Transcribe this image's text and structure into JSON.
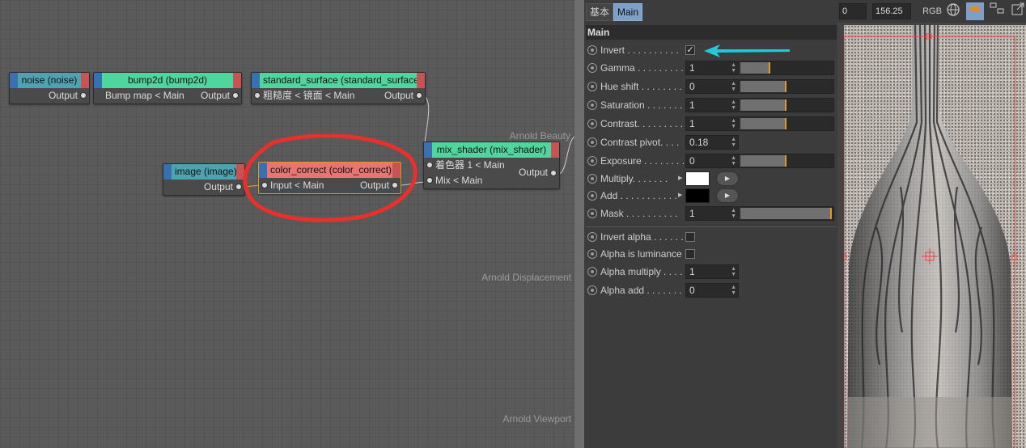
{
  "node_editor": {
    "nodes": {
      "noise": {
        "title": "noise (noise)",
        "output": "Output",
        "color": "#4fa3b0"
      },
      "bump2d": {
        "title": "bump2d (bump2d)",
        "input": "Bump map < Main",
        "output": "Output",
        "color": "#4fd69e"
      },
      "standard_surface": {
        "title": "standard_surface (standard_surface)",
        "input": "粗糙度 < 镜面 < Main",
        "output": "Output",
        "color": "#4fd69e"
      },
      "image": {
        "title": "image (image)",
        "output": "Output",
        "color": "#4fa3b0"
      },
      "color_correct": {
        "title": "color_correct (color_correct)",
        "input": "Input < Main",
        "output": "Output",
        "color": "#e87474"
      },
      "mix_shader": {
        "title": "mix_shader (mix_shader)",
        "input1": "着色器 1 < Main",
        "input2": "Mix < Main",
        "output": "Output",
        "color": "#4fd69e"
      }
    },
    "output_ports": {
      "beauty": "Arnold Beauty",
      "displacement": "Arnold Displacement",
      "viewport": "Arnold Viewport"
    }
  },
  "attr_panel": {
    "tabs": [
      {
        "label": "基本",
        "active": false
      },
      {
        "label": "Main",
        "active": true
      }
    ],
    "section_title": "Main",
    "params": {
      "invert": {
        "label": "Invert . . . . . . . . . .",
        "checked": true,
        "mark": "✓"
      },
      "gamma": {
        "label": "Gamma . . . . . . . . .",
        "value": "1",
        "level": 0.33
      },
      "hue_shift": {
        "label": "Hue shift . . . . . . . .",
        "value": "0",
        "level": 0.5
      },
      "saturation": {
        "label": "Saturation . . . . . . .",
        "value": "1",
        "level": 0.5
      },
      "contrast": {
        "label": "Contrast. . . . . . . . .",
        "value": "1",
        "level": 0.5
      },
      "contrast_pivot": {
        "label": "Contrast pivot. . . .",
        "value": "0.18"
      },
      "exposure": {
        "label": "Exposure . . . . . . . .",
        "value": "0",
        "level": 0.5
      },
      "multiply": {
        "label": "Multiply. . . . . . .",
        "color": "#ffffff"
      },
      "add": {
        "label": "Add . . . . . . . . . . .",
        "color": "#000000"
      },
      "mask": {
        "label": "Mask . . . . . . . . . .",
        "value": "1",
        "level": 1.0
      },
      "invert_alpha": {
        "label": "Invert alpha . . . . . .",
        "checked": false
      },
      "alpha_is_luminance": {
        "label": "Alpha is luminance",
        "checked": false
      },
      "alpha_multiply": {
        "label": "Alpha multiply . . . .",
        "value": "1"
      },
      "alpha_add": {
        "label": "Alpha add . . . . . . . .",
        "value": "0"
      }
    }
  },
  "render_view": {
    "toolbar": {
      "field1": "0",
      "zoom": "156.25",
      "rgb_label": "RGB"
    }
  },
  "colors": {
    "accent_orange": "#e09a2a",
    "annotation_red": "#e8302c",
    "annotation_cyan": "#20c8d8",
    "selection_red": "#e84848"
  }
}
